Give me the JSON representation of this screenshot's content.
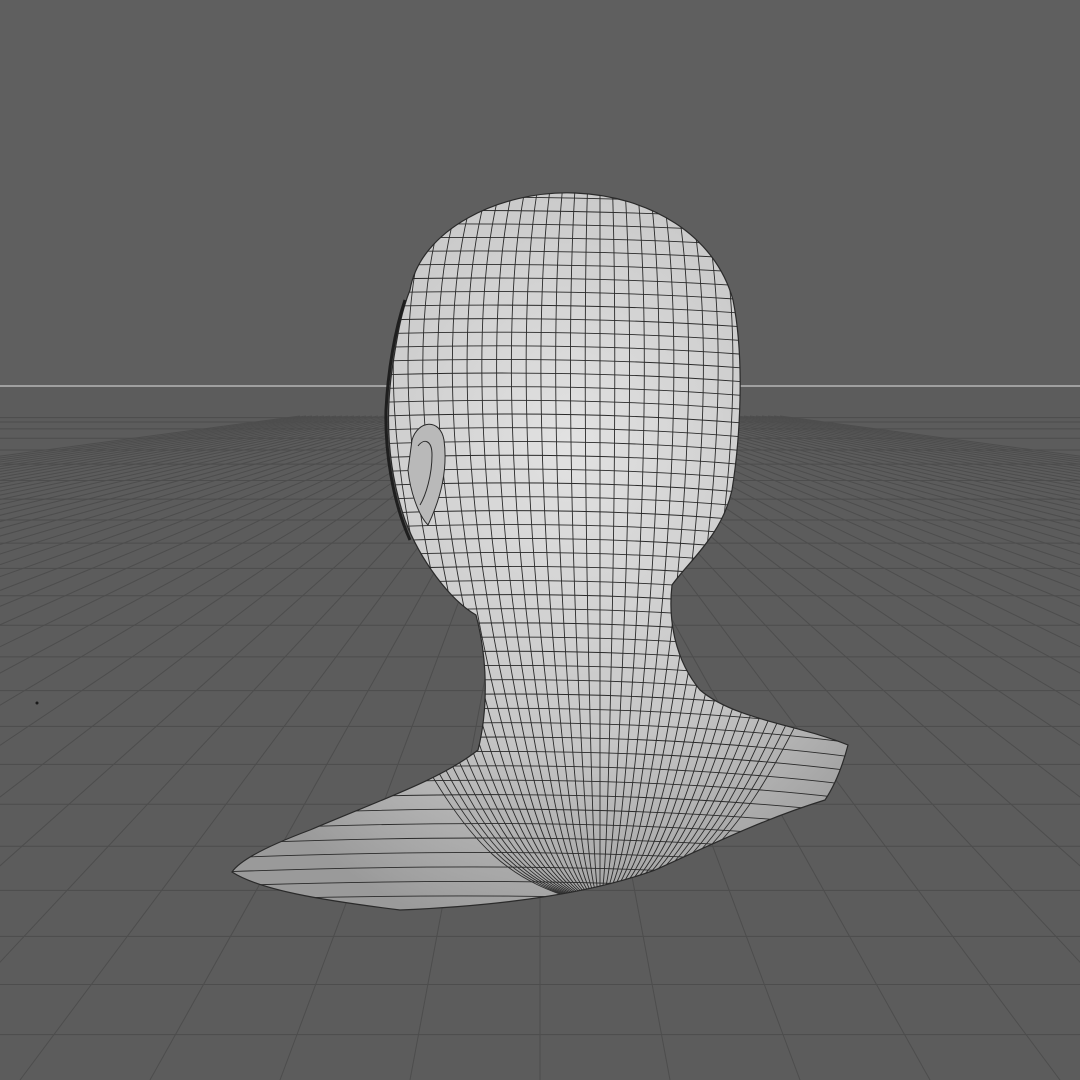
{
  "viewport": {
    "view_mode": "perspective",
    "shading": "wireframe-on-shaded",
    "grid_visible": true,
    "horizon_visible": true,
    "object": "head-and-shoulders-bust",
    "colors": {
      "background": "#5f5f5f",
      "floor": "#5c5c5c",
      "grid_line": "#4b4b4b",
      "horizon_line": "#c8c8c8",
      "mesh_fill": "#c8c8c8",
      "mesh_wire": "#2a2a2a"
    }
  }
}
